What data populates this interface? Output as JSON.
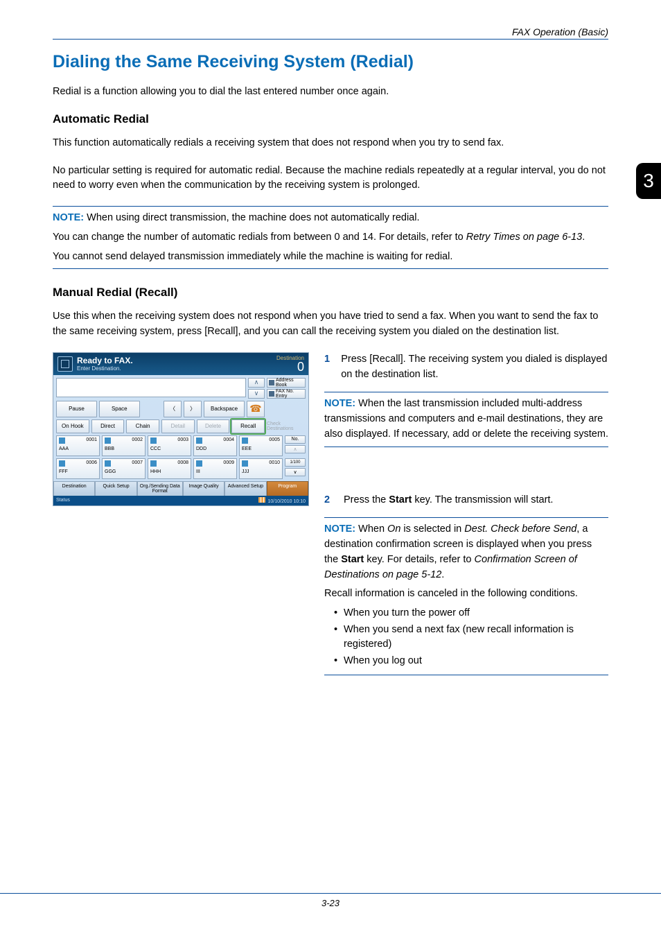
{
  "header": {
    "right": "FAX Operation (Basic)"
  },
  "side_chapter": "3",
  "title": "Dialing the Same Receiving System (Redial)",
  "intro": "Redial is a function allowing you to dial the last entered number once again.",
  "auto": {
    "heading": "Automatic Redial",
    "p1": "This function automatically redials a receiving system that does not respond when you try to send fax.",
    "p2": "No particular setting is required for automatic redial. Because the machine redials repeatedly at a regular interval, you do not need to worry even when the communication by the receiving system is prolonged.",
    "note_label": "NOTE:",
    "note_l1": " When using direct transmission, the machine does not automatically redial.",
    "note_l2_a": "You can change the number of automatic redials from between 0 and 14. For details, refer to ",
    "note_l2_i": "Retry Times on page 6-13",
    "note_l2_b": ".",
    "note_l3": "You cannot send delayed transmission immediately while the machine is waiting for redial."
  },
  "manual": {
    "heading": "Manual Redial (Recall)",
    "p1": "Use this when the receiving system does not respond when you have tried to send a fax. When you want to send the fax to the same receiving system, press [Recall], and you can call the receiving system you dialed on the destination list."
  },
  "steps": {
    "s1_num": "1",
    "s1_text": "Press [Recall]. The receiving system you dialed is displayed on the destination list.",
    "note1_label": "NOTE:",
    "note1_text": " When the last transmission included multi-address transmissions and computers and e-mail destinations, they are also displayed. If necessary, add or delete the receiving system.",
    "s2_num": "2",
    "s2_text_a": "Press the ",
    "s2_text_b": "Start",
    "s2_text_c": " key. The transmission will start.",
    "note2_label": "NOTE:",
    "note2_a": " When ",
    "note2_i1": "On",
    "note2_b": " is selected in ",
    "note2_i2": "Dest. Check before Send",
    "note2_c": ", a destination confirmation screen is displayed when you press the ",
    "note2_bold": "Start",
    "note2_d": " key. For details, refer to ",
    "note2_i3": "Confirmation Screen of Destinations on page 5-12",
    "note2_e": ".",
    "note2_p2": "Recall information is canceled in the following conditions.",
    "bul1": "When you turn the power off",
    "bul2": "When you send a next fax (new recall information is registered)",
    "bul3": "When you log out"
  },
  "panel": {
    "title": "Ready to FAX.",
    "subtitle": "Enter Destination.",
    "dest_label": "Destination",
    "dest_count": "0",
    "addr_book": "Address Book",
    "fax_entry": "FAX No. Entry",
    "pause": "Pause",
    "space": "Space",
    "backspace": "Backspace",
    "onhook": "On Hook",
    "direct": "Direct",
    "chain": "Chain",
    "detail": "Detail",
    "delete": "Delete",
    "recall": "Recall",
    "check": "Check Destinations",
    "no_btn": "No.",
    "page": "1/100",
    "cards": [
      {
        "num": "0001",
        "name": "AAA"
      },
      {
        "num": "0002",
        "name": "BBB"
      },
      {
        "num": "0003",
        "name": "CCC"
      },
      {
        "num": "0004",
        "name": "DDD"
      },
      {
        "num": "0005",
        "name": "EEE"
      },
      {
        "num": "0006",
        "name": "FFF"
      },
      {
        "num": "0007",
        "name": "GGG"
      },
      {
        "num": "0008",
        "name": "HHH"
      },
      {
        "num": "0009",
        "name": "III"
      },
      {
        "num": "0010",
        "name": "JJJ"
      }
    ],
    "tabs": {
      "dest": "Destination",
      "quick": "Quick Setup",
      "org": "Org./Sending Data Format",
      "img": "Image Quality",
      "adv": "Advanced Setup",
      "prog": "Program"
    },
    "status": "Status",
    "datetime": "10/10/2010  10:10"
  },
  "footer": "3-23"
}
